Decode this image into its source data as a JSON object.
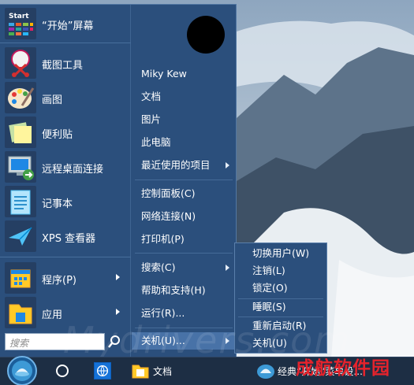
{
  "left_apps": [
    {
      "label": "“开始”屏幕",
      "icon": "start-screen-icon",
      "icon_text": "Start"
    },
    {
      "label": "截图工具",
      "icon": "snipping-tool-icon"
    },
    {
      "label": "画图",
      "icon": "paint-icon"
    },
    {
      "label": "便利贴",
      "icon": "sticky-notes-icon"
    },
    {
      "label": "远程桌面连接",
      "icon": "remote-desktop-icon"
    },
    {
      "label": "记事本",
      "icon": "notepad-icon"
    },
    {
      "label": "XPS 查看器",
      "icon": "xps-viewer-icon"
    }
  ],
  "programs": {
    "label": "程序(P)",
    "icon": "programs-icon"
  },
  "apps": {
    "label": "应用",
    "icon": "apps-icon"
  },
  "search": {
    "placeholder": "搜索"
  },
  "right_menu": {
    "user_name": "Miky Kew",
    "documents": "文档",
    "pictures": "图片",
    "this_pc": "此电脑",
    "recent_items": "最近使用的项目",
    "control_panel": "控制面板(C)",
    "network": "网络连接(N)",
    "printers": "打印机(P)",
    "search": "搜索(C)",
    "help": "帮助和支持(H)",
    "run": "运行(R)...",
    "shutdown": "关机(U)..."
  },
  "power_submenu": {
    "switch_user": "切换用户(W)",
    "logoff": "注销(L)",
    "lock": "锁定(O)",
    "sleep": "睡眠(S)",
    "restart": "重新启动(R)",
    "shutdown": "关机(U)"
  },
  "taskbar": {
    "explorer_label": "文档",
    "classic_label": "经典“开始”菜单设..."
  },
  "watermark": "Mydrivers.com",
  "watermark_cn": "成航软件园",
  "colors": {
    "menu_bg": "#2b4f7c",
    "hover": "#4872a7",
    "taskbar": "#1d2e44",
    "watermark_red": "#e5232c"
  }
}
